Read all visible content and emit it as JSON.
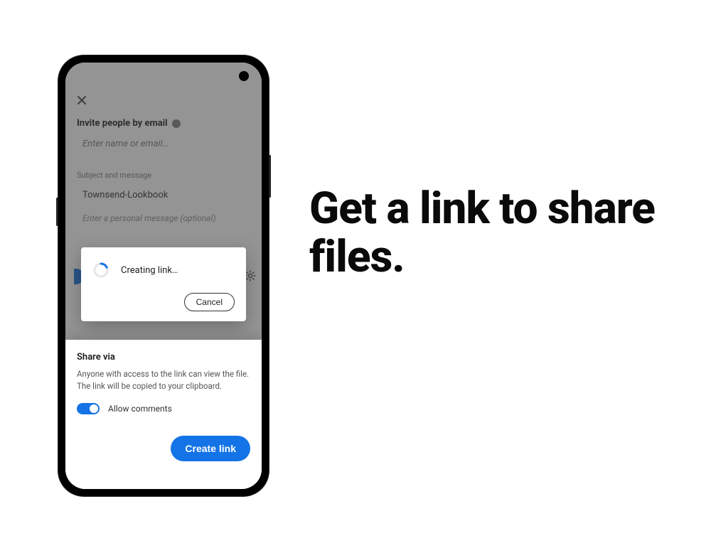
{
  "headline": "Get a link to share files.",
  "phone": {
    "invite_label": "Invite people by email",
    "name_placeholder": "Enter name or email…",
    "subject_section_label": "Subject and message",
    "subject_value": "Townsend-Lookbook",
    "personal_message_placeholder": "Enter a personal message (optional)"
  },
  "modal": {
    "status_text": "Creating link…",
    "cancel_label": "Cancel"
  },
  "sheet": {
    "title": "Share via",
    "description_line1": "Anyone with access to the link can view the file.",
    "description_line2": "The link will be copied to your clipboard.",
    "allow_comments_label": "Allow comments",
    "allow_comments_on": true,
    "create_link_label": "Create link"
  },
  "colors": {
    "accent": "#1473e6"
  }
}
